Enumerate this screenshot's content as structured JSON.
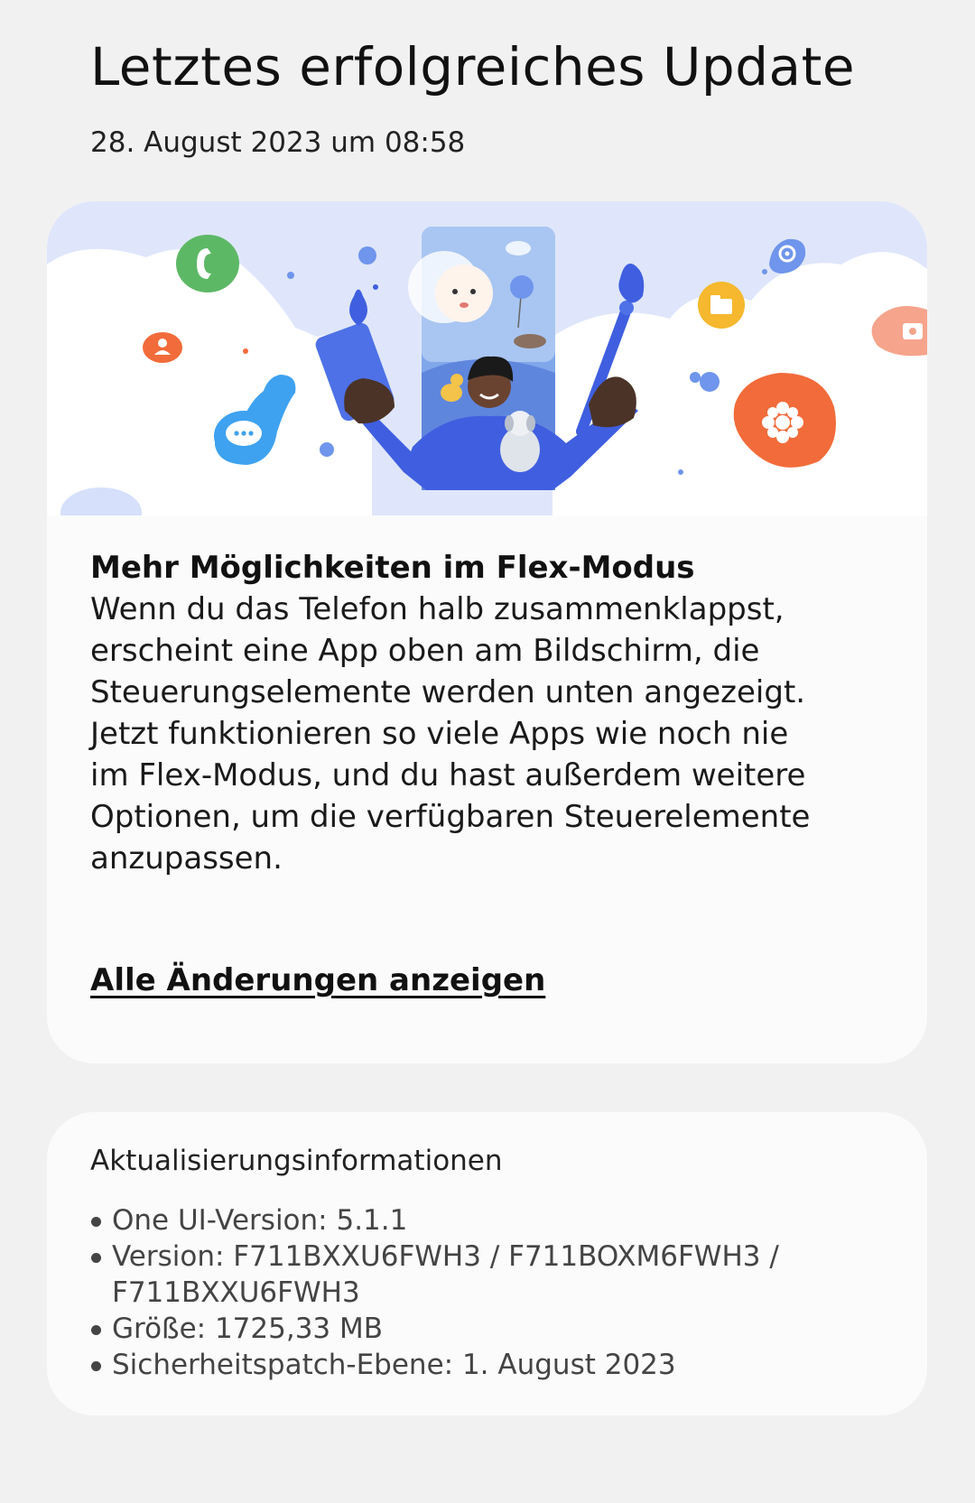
{
  "header": {
    "title": "Letztes erfolgreiches Update",
    "date": "28. August 2023 um 08:58"
  },
  "feature": {
    "title": "Mehr Möglichkeiten im Flex-Modus",
    "body": "Wenn du das Telefon halb zusammenklappst,\nerscheint eine App oben am Bildschirm, die\nSteuerungselemente werden unten angezeigt.\nJetzt funktionieren so viele Apps wie noch nie\nim Flex-Modus, und du hast außerdem weitere\nOptionen, um die verfügbaren Steuerelemente\nanzupassen.",
    "link_label": "Alle Änderungen anzeigen"
  },
  "info": {
    "heading": "Aktualisierungsinformationen",
    "items": [
      "One UI-Version: 5.1.1",
      "Version: F711BXXU6FWH3 / F711BOXM6FWH3 / F711BXXU6FWH3",
      "Größe: 1725,33 MB",
      "Sicherheitspatch-Ebene: 1. August 2023"
    ]
  },
  "colors": {
    "background": "#f2f1f2",
    "card": "#fbfbfb",
    "banner_sky": "#dfe6fb",
    "figure_blue": "#3f5fe0",
    "phone_green": "#5db866",
    "gallery_orange": "#f26b3a",
    "folder_yellow": "#f5b82e",
    "message_blue": "#3ea2f0"
  }
}
